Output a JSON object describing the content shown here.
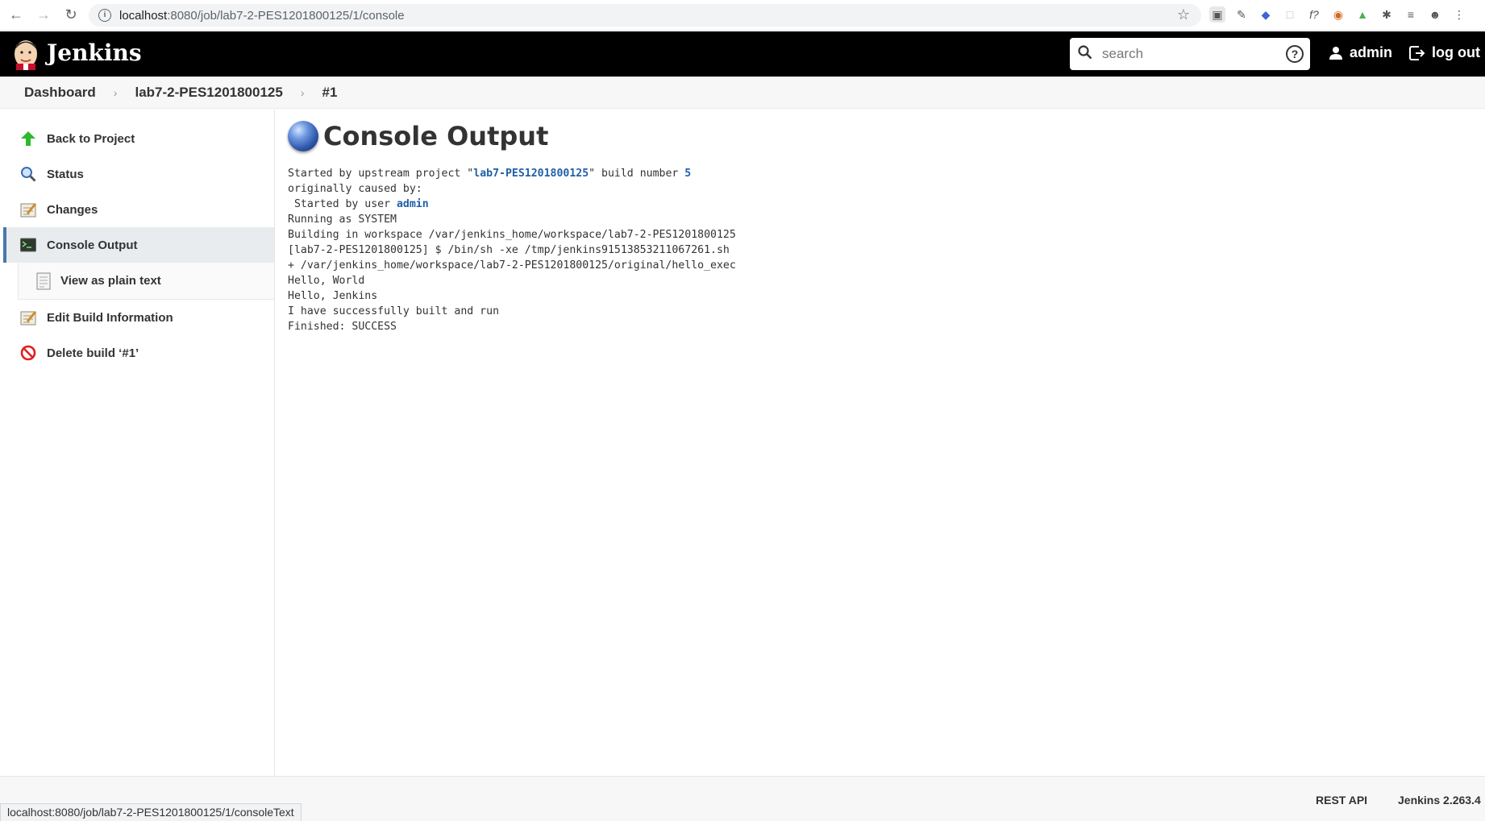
{
  "browser": {
    "url_host": "localhost",
    "url_rest": ":8080/job/lab7-2-PES1201800125/1/console",
    "extensions": [
      "ext-1",
      "ext-2",
      "ext-3",
      "ext-4",
      "ext-5",
      "ext-6",
      "ext-7",
      "ext-8",
      "ext-9"
    ]
  },
  "header": {
    "title": "Jenkins",
    "search_placeholder": "search",
    "help_label": "?",
    "user_label": "admin",
    "logout_label": "log out"
  },
  "breadcrumb": {
    "items": [
      "Dashboard",
      "lab7-2-PES1201800125",
      "#1"
    ]
  },
  "sidebar": {
    "items": [
      {
        "label": "Back to Project"
      },
      {
        "label": "Status"
      },
      {
        "label": "Changes"
      },
      {
        "label": "Console Output"
      },
      {
        "label": "View as plain text"
      },
      {
        "label": "Edit Build Information"
      },
      {
        "label": "Delete build ‘#1’"
      }
    ]
  },
  "main": {
    "title": "Console Output",
    "console": {
      "line1_pre": "Started by upstream project \"",
      "line1_link": "lab7-PES1201800125",
      "line1_mid": "\" build number ",
      "line1_num": "5",
      "line2": "originally caused by:",
      "line3_pre": " Started by user ",
      "line3_link": "admin",
      "line4": "Running as SYSTEM",
      "line5": "Building in workspace /var/jenkins_home/workspace/lab7-2-PES1201800125",
      "line6": "[lab7-2-PES1201800125] $ /bin/sh -xe /tmp/jenkins915138532110672­61.sh",
      "line7": "+ /var/jenkins_home/workspace/lab7-2-PES1201800125/original/hello_exec",
      "line8": "Hello, World",
      "line9": "Hello, Jenkins",
      "line10": "I have successfully built and run",
      "line11": "Finished: SUCCESS"
    }
  },
  "footer": {
    "rest_api": "REST API",
    "version": "Jenkins 2.263.4"
  },
  "status_bar": {
    "url": "localhost:8080/job/lab7-2-PES1201800125/1/consoleText"
  }
}
